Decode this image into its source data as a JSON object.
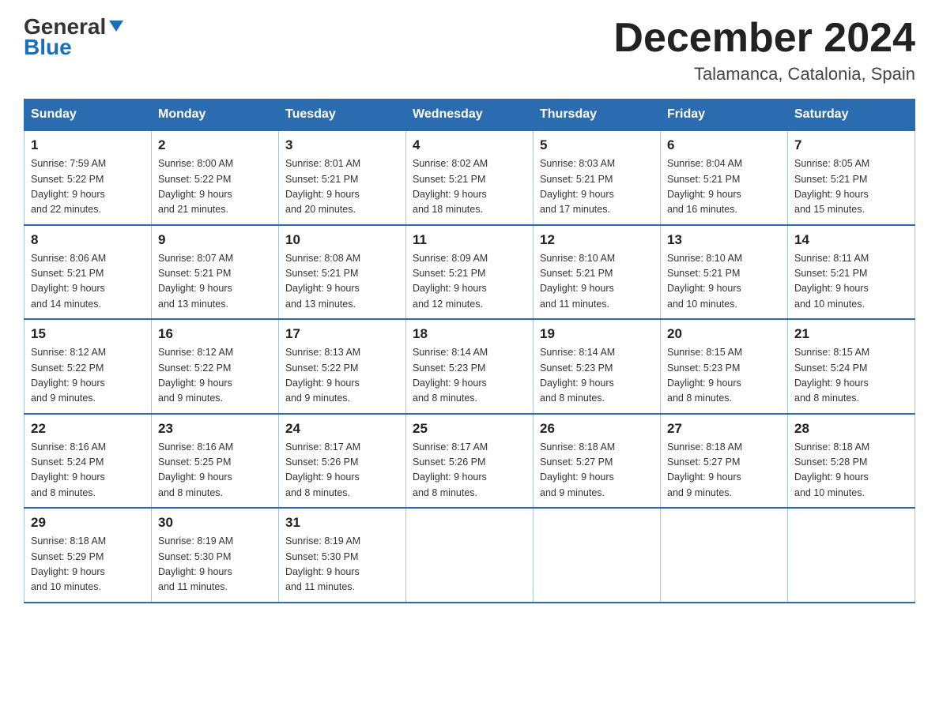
{
  "header": {
    "logo_general": "General",
    "logo_blue": "Blue",
    "month_title": "December 2024",
    "location": "Talamanca, Catalonia, Spain"
  },
  "weekdays": [
    "Sunday",
    "Monday",
    "Tuesday",
    "Wednesday",
    "Thursday",
    "Friday",
    "Saturday"
  ],
  "weeks": [
    [
      {
        "day": "1",
        "sunrise": "7:59 AM",
        "sunset": "5:22 PM",
        "daylight": "9 hours and 22 minutes."
      },
      {
        "day": "2",
        "sunrise": "8:00 AM",
        "sunset": "5:22 PM",
        "daylight": "9 hours and 21 minutes."
      },
      {
        "day": "3",
        "sunrise": "8:01 AM",
        "sunset": "5:21 PM",
        "daylight": "9 hours and 20 minutes."
      },
      {
        "day": "4",
        "sunrise": "8:02 AM",
        "sunset": "5:21 PM",
        "daylight": "9 hours and 18 minutes."
      },
      {
        "day": "5",
        "sunrise": "8:03 AM",
        "sunset": "5:21 PM",
        "daylight": "9 hours and 17 minutes."
      },
      {
        "day": "6",
        "sunrise": "8:04 AM",
        "sunset": "5:21 PM",
        "daylight": "9 hours and 16 minutes."
      },
      {
        "day": "7",
        "sunrise": "8:05 AM",
        "sunset": "5:21 PM",
        "daylight": "9 hours and 15 minutes."
      }
    ],
    [
      {
        "day": "8",
        "sunrise": "8:06 AM",
        "sunset": "5:21 PM",
        "daylight": "9 hours and 14 minutes."
      },
      {
        "day": "9",
        "sunrise": "8:07 AM",
        "sunset": "5:21 PM",
        "daylight": "9 hours and 13 minutes."
      },
      {
        "day": "10",
        "sunrise": "8:08 AM",
        "sunset": "5:21 PM",
        "daylight": "9 hours and 13 minutes."
      },
      {
        "day": "11",
        "sunrise": "8:09 AM",
        "sunset": "5:21 PM",
        "daylight": "9 hours and 12 minutes."
      },
      {
        "day": "12",
        "sunrise": "8:10 AM",
        "sunset": "5:21 PM",
        "daylight": "9 hours and 11 minutes."
      },
      {
        "day": "13",
        "sunrise": "8:10 AM",
        "sunset": "5:21 PM",
        "daylight": "9 hours and 10 minutes."
      },
      {
        "day": "14",
        "sunrise": "8:11 AM",
        "sunset": "5:21 PM",
        "daylight": "9 hours and 10 minutes."
      }
    ],
    [
      {
        "day": "15",
        "sunrise": "8:12 AM",
        "sunset": "5:22 PM",
        "daylight": "9 hours and 9 minutes."
      },
      {
        "day": "16",
        "sunrise": "8:12 AM",
        "sunset": "5:22 PM",
        "daylight": "9 hours and 9 minutes."
      },
      {
        "day": "17",
        "sunrise": "8:13 AM",
        "sunset": "5:22 PM",
        "daylight": "9 hours and 9 minutes."
      },
      {
        "day": "18",
        "sunrise": "8:14 AM",
        "sunset": "5:23 PM",
        "daylight": "9 hours and 8 minutes."
      },
      {
        "day": "19",
        "sunrise": "8:14 AM",
        "sunset": "5:23 PM",
        "daylight": "9 hours and 8 minutes."
      },
      {
        "day": "20",
        "sunrise": "8:15 AM",
        "sunset": "5:23 PM",
        "daylight": "9 hours and 8 minutes."
      },
      {
        "day": "21",
        "sunrise": "8:15 AM",
        "sunset": "5:24 PM",
        "daylight": "9 hours and 8 minutes."
      }
    ],
    [
      {
        "day": "22",
        "sunrise": "8:16 AM",
        "sunset": "5:24 PM",
        "daylight": "9 hours and 8 minutes."
      },
      {
        "day": "23",
        "sunrise": "8:16 AM",
        "sunset": "5:25 PM",
        "daylight": "9 hours and 8 minutes."
      },
      {
        "day": "24",
        "sunrise": "8:17 AM",
        "sunset": "5:26 PM",
        "daylight": "9 hours and 8 minutes."
      },
      {
        "day": "25",
        "sunrise": "8:17 AM",
        "sunset": "5:26 PM",
        "daylight": "9 hours and 8 minutes."
      },
      {
        "day": "26",
        "sunrise": "8:18 AM",
        "sunset": "5:27 PM",
        "daylight": "9 hours and 9 minutes."
      },
      {
        "day": "27",
        "sunrise": "8:18 AM",
        "sunset": "5:27 PM",
        "daylight": "9 hours and 9 minutes."
      },
      {
        "day": "28",
        "sunrise": "8:18 AM",
        "sunset": "5:28 PM",
        "daylight": "9 hours and 10 minutes."
      }
    ],
    [
      {
        "day": "29",
        "sunrise": "8:18 AM",
        "sunset": "5:29 PM",
        "daylight": "9 hours and 10 minutes."
      },
      {
        "day": "30",
        "sunrise": "8:19 AM",
        "sunset": "5:30 PM",
        "daylight": "9 hours and 11 minutes."
      },
      {
        "day": "31",
        "sunrise": "8:19 AM",
        "sunset": "5:30 PM",
        "daylight": "9 hours and 11 minutes."
      },
      null,
      null,
      null,
      null
    ]
  ],
  "labels": {
    "sunrise": "Sunrise:",
    "sunset": "Sunset:",
    "daylight": "Daylight:"
  }
}
